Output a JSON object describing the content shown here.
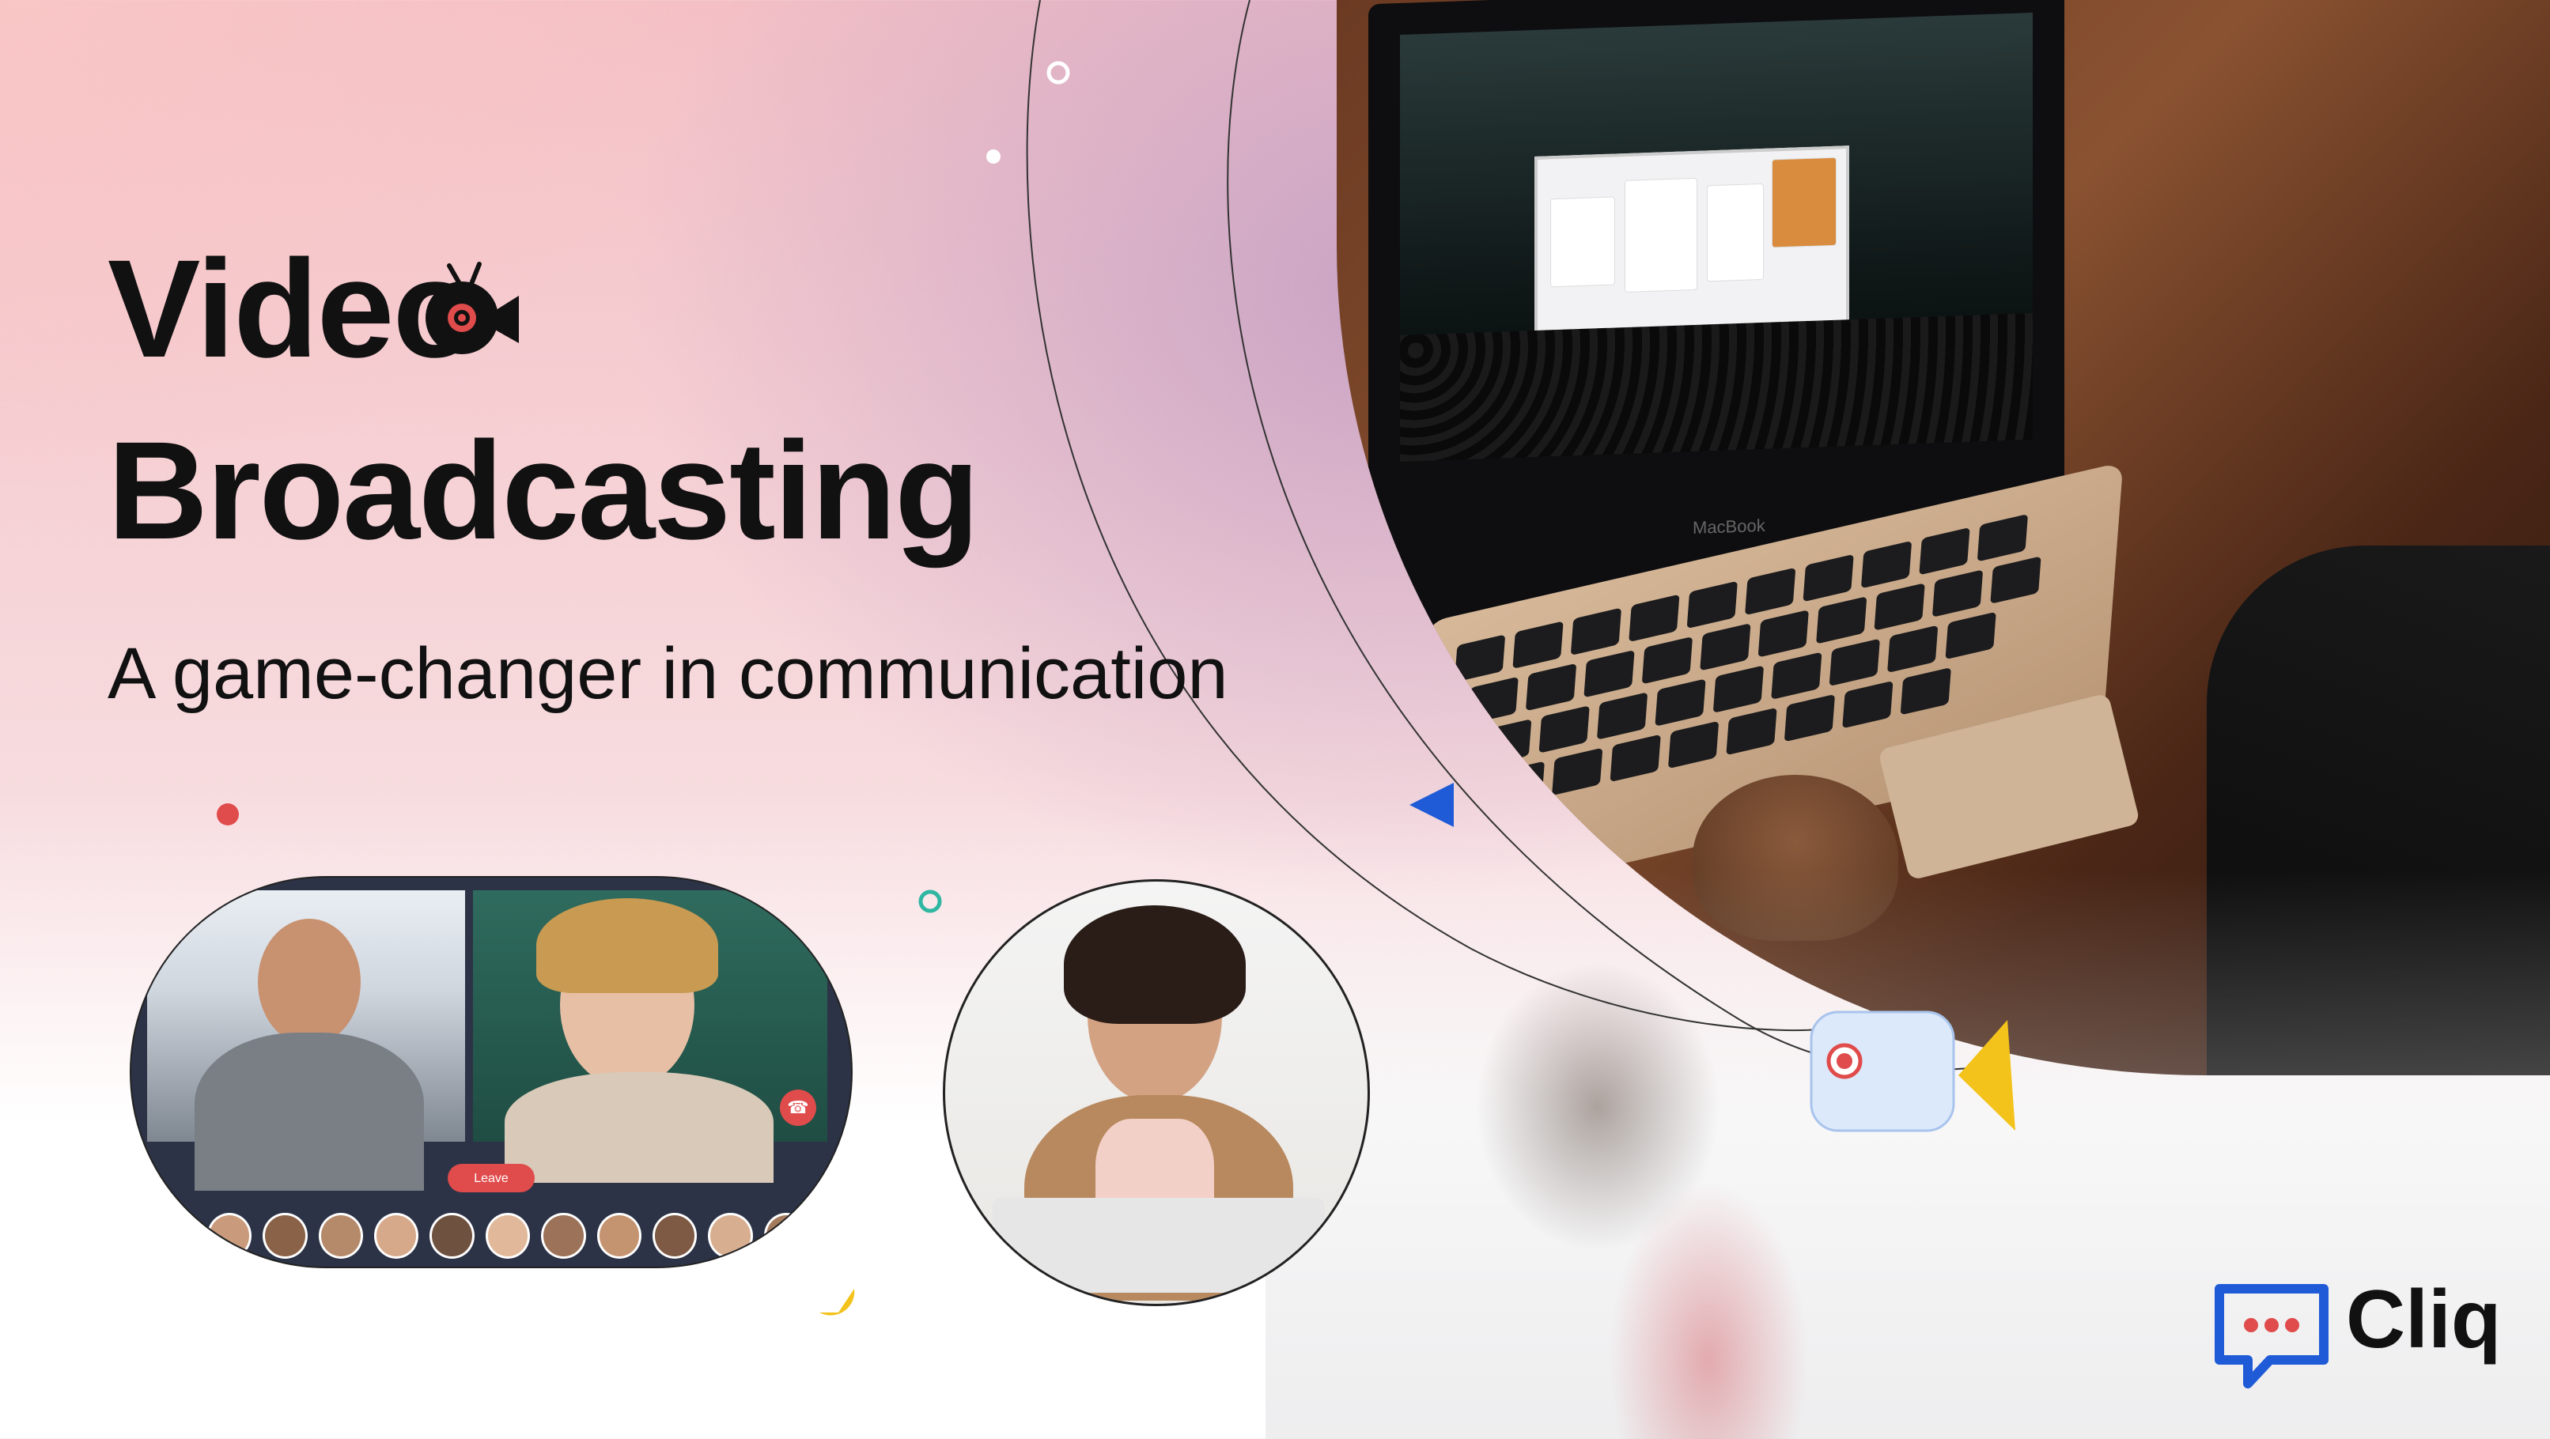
{
  "title": {
    "line1": "Video",
    "line2": "Broadcasting",
    "subtitle": "A game-changer in communication"
  },
  "video_call": {
    "leave_label": "Leave",
    "participant_count": 11
  },
  "laptop": {
    "brand_label": "MacBook"
  },
  "brand": {
    "name": "Cliq",
    "logo_icon": "cliq-chat-bubble-icon"
  },
  "colors": {
    "accent_red": "#e04b4b",
    "accent_blue": "#1f5bd6",
    "accent_yellow": "#f3c21b",
    "accent_teal": "#2fb7a2",
    "text": "#111111"
  }
}
